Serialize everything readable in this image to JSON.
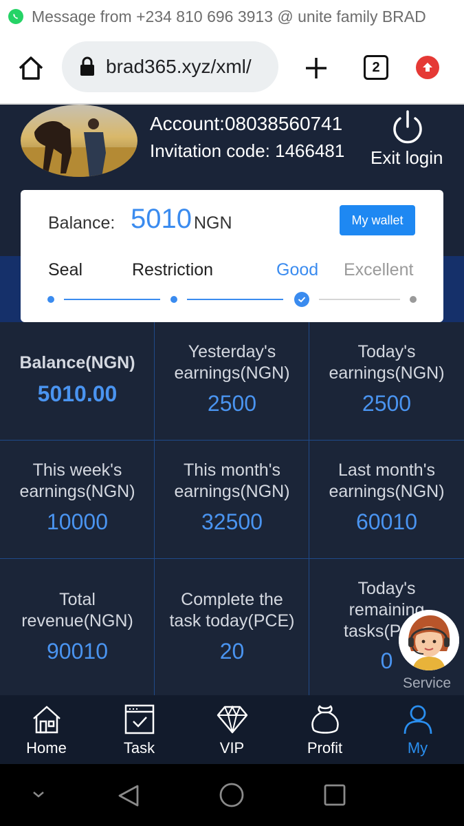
{
  "notification": {
    "icon": "whatsapp-icon",
    "text": "Message from +234 810 696 3913 @ unite family BRAD"
  },
  "browser": {
    "url": "brad365.xyz/xml/",
    "tab_count": "2"
  },
  "profile": {
    "account": "Account:08038560741",
    "invitation": "Invitation code:  1466481",
    "exit_label": "Exit login"
  },
  "balance_card": {
    "label": "Balance:",
    "value": "5010",
    "unit": "NGN",
    "wallet_button": "My wallet",
    "levels": [
      "Seal",
      "Restriction",
      "Good",
      "Excellent"
    ],
    "active_level": "Good",
    "accent": "#3a8bef"
  },
  "stats": [
    {
      "label": "Balance(NGN)",
      "value": "5010.00"
    },
    {
      "label": "Yesterday's earnings(NGN)",
      "value": "2500"
    },
    {
      "label": "Today's earnings(NGN)",
      "value": "2500"
    },
    {
      "label": "This week's earnings(NGN)",
      "value": "10000"
    },
    {
      "label": "This month's earnings(NGN)",
      "value": "32500"
    },
    {
      "label": "Last month's earnings(NGN)",
      "value": "60010"
    },
    {
      "label": "Total revenue(NGN)",
      "value": "90010"
    },
    {
      "label": "Complete the task today(PCE)",
      "value": "20"
    },
    {
      "label": "Today's remaining tasks(PCE)",
      "value": "0"
    }
  ],
  "service": {
    "label": "Service"
  },
  "nav": {
    "items": [
      {
        "label": "Home",
        "icon": "home-icon"
      },
      {
        "label": "Task",
        "icon": "task-icon"
      },
      {
        "label": "VIP",
        "icon": "diamond-icon"
      },
      {
        "label": "Profit",
        "icon": "money-bag-icon"
      },
      {
        "label": "My",
        "icon": "user-icon"
      }
    ],
    "active": "My",
    "active_color": "#2a8ff0"
  }
}
